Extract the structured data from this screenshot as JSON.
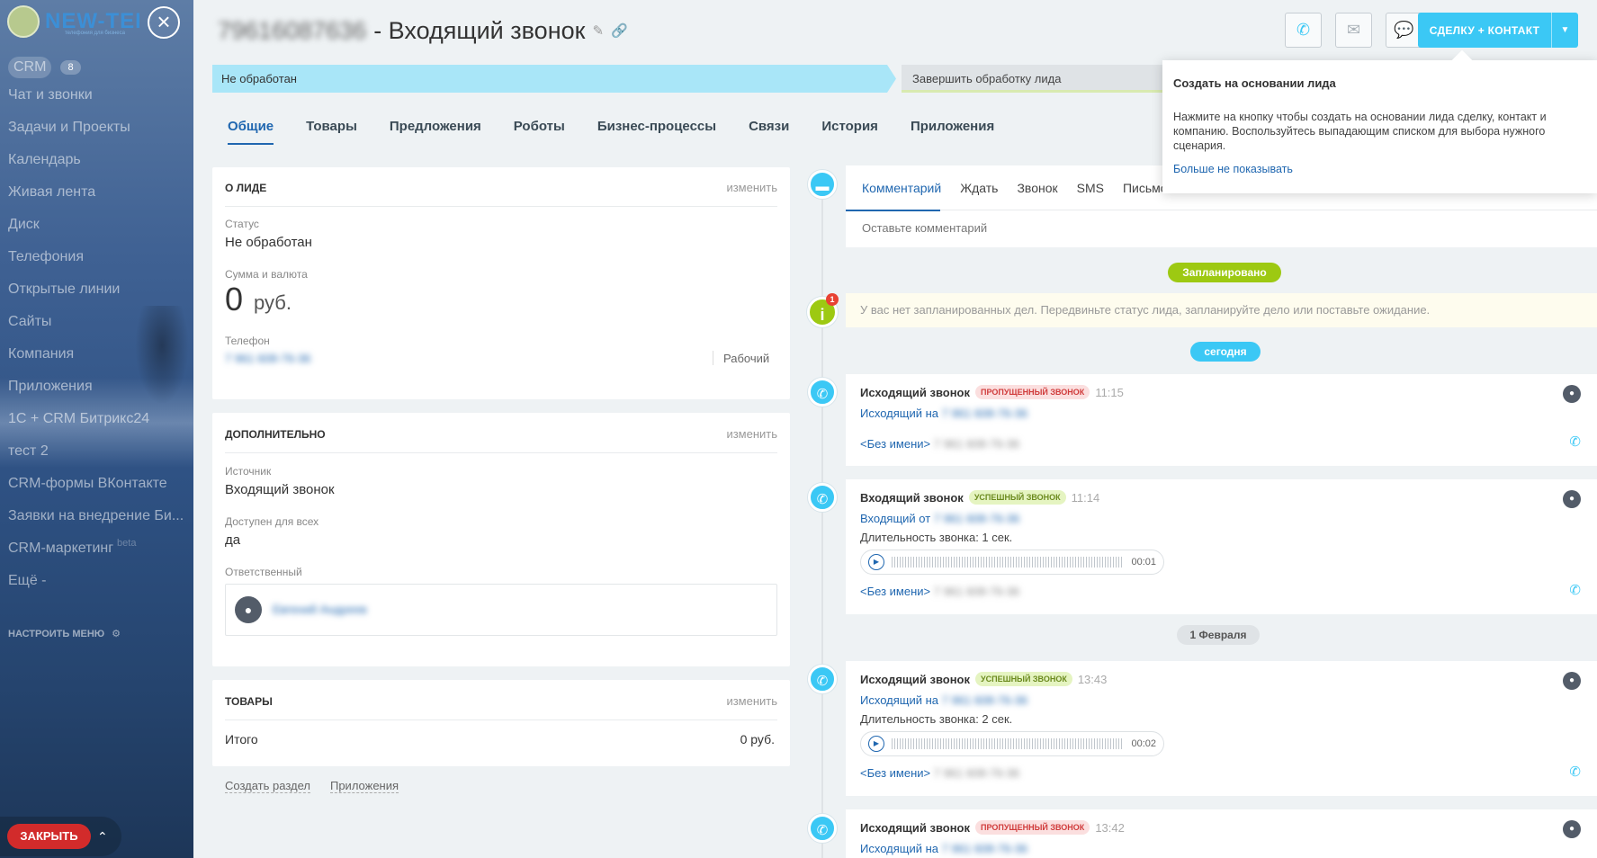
{
  "sidebar": {
    "logo_text": "NEW-TEL",
    "logo_tagline": "телефония для бизнеса",
    "items": [
      {
        "label": "CRM",
        "count": "8"
      },
      {
        "label": "Чат и звонки"
      },
      {
        "label": "Задачи и Проекты"
      },
      {
        "label": "Календарь"
      },
      {
        "label": "Живая лента"
      },
      {
        "label": "Диск"
      },
      {
        "label": "Телефония"
      },
      {
        "label": "Открытые линии"
      },
      {
        "label": "Сайты"
      },
      {
        "label": "Компания"
      },
      {
        "label": "Приложения"
      },
      {
        "label": "1С + CRM Битрикс24"
      },
      {
        "label": "тест 2"
      },
      {
        "label": "CRM-формы ВКонтакте"
      },
      {
        "label": "Заявки на внедрение Би..."
      },
      {
        "label": "CRM-маркетинг",
        "suffix": "beta"
      },
      {
        "label": "Ещё -"
      }
    ],
    "configure_menu": "НАСТРОИТЬ МЕНЮ",
    "close_button": "ЗАКРЫТЬ"
  },
  "header": {
    "phone_number": "79616087636",
    "title": "- Входящий звонок",
    "deal_button": "СДЕЛКУ + КОНТАКТ"
  },
  "stages": {
    "current": "Не обработан",
    "finish": "Завершить обработку лида"
  },
  "tabs": [
    "Общие",
    "Товары",
    "Предложения",
    "Роботы",
    "Бизнес-процессы",
    "Связи",
    "История",
    "Приложения"
  ],
  "about_lead": {
    "title": "О ЛИДЕ",
    "edit": "изменить",
    "status_label": "Статус",
    "status_value": "Не обработан",
    "sum_label": "Сумма и валюта",
    "sum_value": "0",
    "currency": "руб.",
    "phone_label": "Телефон",
    "phone_value": "7 961 608-76-36",
    "phone_type": "Рабочий"
  },
  "additional": {
    "title": "ДОПОЛНИТЕЛЬНО",
    "edit": "изменить",
    "source_label": "Источник",
    "source_value": "Входящий звонок",
    "available_label": "Доступен для всех",
    "available_value": "да",
    "responsible_label": "Ответственный",
    "responsible_name": "Евгений Андреев"
  },
  "products": {
    "title": "ТОВАРЫ",
    "edit": "изменить",
    "total_label": "Итого",
    "total_value": "0 руб."
  },
  "bottom_links": [
    "Создать раздел",
    "Приложения"
  ],
  "comment_tabs": [
    "Комментарий",
    "Ждать",
    "Звонок",
    "SMS",
    "Письмо"
  ],
  "comment_placeholder": "Оставьте комментарий",
  "planned_label": "Запланировано",
  "planned_note": "У вас нет запланированных дел. Передвиньте статус лида, запланируйте дело или поставьте ожидание.",
  "info_badge_count": "1",
  "today_label": "сегодня",
  "feb_label": "1 Февраля",
  "activities": [
    {
      "title": "Исходящий звонок",
      "badge": "ПРОПУЩЕННЫЙ ЗВОНОК",
      "time": "11:15",
      "line": "Исходящий на",
      "number": "7 961 608-76-36",
      "contact": "<Без имени>",
      "contact_number": "7 961 608-76-36"
    },
    {
      "title": "Входящий звонок",
      "badge": "УСПЕШНЫЙ ЗВОНОК",
      "time": "11:14",
      "line": "Входящий от",
      "number": "7 961 608-76-36",
      "duration": "Длительность звонка: 1 сек.",
      "player_time": "00:01",
      "contact": "<Без имени>",
      "contact_number": "7 961 608-76-36"
    },
    {
      "title": "Исходящий звонок",
      "badge": "УСПЕШНЫЙ ЗВОНОК",
      "time": "13:43",
      "line": "Исходящий на",
      "number": "7 961 608-76-36",
      "duration": "Длительность звонка: 2 сек.",
      "player_time": "00:02",
      "contact": "<Без имени>",
      "contact_number": "7 961 608-76-36"
    },
    {
      "title": "Исходящий звонок",
      "badge": "ПРОПУЩЕННЫЙ ЗВОНОК",
      "time": "13:42",
      "line": "Исходящий на",
      "number": "7 961 608-76-36"
    }
  ],
  "popup": {
    "title": "Создать на основании лида",
    "body": "Нажмите на кнопку чтобы создать на основании лида сделку, контакт и компанию. Воспользуйтесь выпадающим списком для выбора нужного сценария.",
    "link": "Больше не показывать"
  },
  "icons": {
    "close": "close-icon",
    "edit": "pencil-icon",
    "link": "link-icon",
    "call": "phone-icon",
    "mail": "mail-icon",
    "chat": "chat-icon",
    "settings": "gear-icon",
    "comment": "comment-icon",
    "info": "info-icon",
    "user": "user-icon",
    "play": "play-icon"
  },
  "colors": {
    "accent": "#3bc8f5",
    "link": "#2067b0",
    "planned": "#9dc912",
    "danger": "#d22b2b",
    "stage": "#a9e6f8"
  }
}
